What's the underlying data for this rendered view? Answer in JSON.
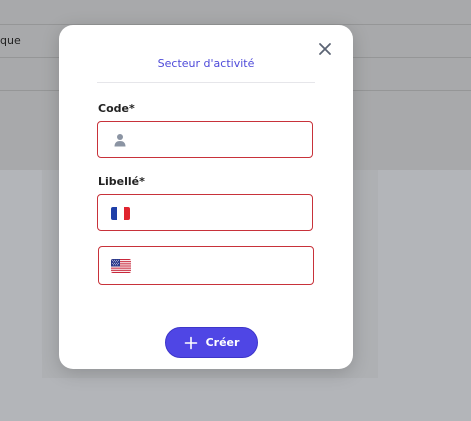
{
  "background": {
    "cell_text": "que"
  },
  "modal": {
    "title": "Secteur d'activité",
    "fields": {
      "code": {
        "label": "Code*",
        "value": ""
      },
      "libelle": {
        "label": "Libellé*",
        "fr_value": "",
        "en_value": ""
      }
    },
    "create_label": "Créer"
  },
  "colors": {
    "accent": "#4f46e5",
    "title": "#4d49d9",
    "error_border": "#c8323a"
  },
  "icons": {
    "close": "close-icon",
    "code": "user-icon",
    "fr": "flag-france-icon",
    "en": "flag-usa-icon",
    "create": "plus-icon"
  }
}
